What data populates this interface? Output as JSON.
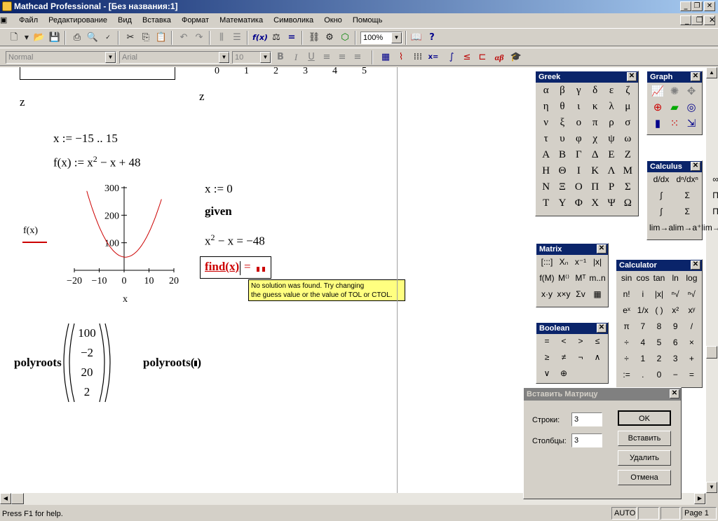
{
  "window": {
    "title": "Mathcad Professional - [Без названия:1]"
  },
  "menu": [
    "Файл",
    "Редактирование",
    "Вид",
    "Вставка",
    "Формат",
    "Математика",
    "Символика",
    "Окно",
    "Помощь"
  ],
  "toolbar": {
    "zoom": "100%"
  },
  "format": {
    "style": "Normal",
    "font": "Arial",
    "size": "10",
    "bold": "B",
    "italic": "I",
    "underline": "U"
  },
  "math_toolbar": {
    "eval": "x=",
    "greek": "αβ"
  },
  "worksheet": {
    "top_ticks": [
      "0",
      "1",
      "2",
      "3",
      "4",
      "5"
    ],
    "z_left": "z",
    "z_right": "z",
    "range_def": "x := −15 .. 15",
    "func_def_prefix": "f(x) := x",
    "func_def_exp": "2",
    "func_def_suffix": " − x + 48",
    "x_init": "x := 0",
    "given": "given",
    "eq_prefix": "x",
    "eq_exp": "2",
    "eq_suffix": " − x = −48",
    "find_expr": "find(x)",
    "find_eq": "=",
    "tooltip_line1": "No solution was found. Try changing",
    "tooltip_line2": "the guess value or the value of TOL or CTOL.",
    "polyroots": "polyroots",
    "vector": [
      "100",
      "−2",
      "20",
      "2"
    ],
    "polyroots2": "polyroots",
    "plot": {
      "ylabel": "f(x)",
      "xlabel": "x",
      "yticks": [
        "300",
        "200",
        "100"
      ],
      "xticks": [
        "−20",
        "−10",
        "0",
        "10",
        "20"
      ]
    }
  },
  "chart_data": {
    "type": "line",
    "xlabel": "x",
    "ylabel": "f(x)",
    "xlim": [
      -20,
      20
    ],
    "ylim": [
      0,
      300
    ],
    "series": [
      {
        "x": [
          -15,
          -12,
          -9,
          -6,
          -3,
          0,
          3,
          6,
          9,
          12,
          15
        ],
        "y": [
          288,
          204,
          138,
          90,
          60,
          48,
          54,
          78,
          120,
          180,
          258
        ]
      }
    ]
  },
  "greek": {
    "title": "Greek",
    "letters": [
      "α",
      "β",
      "γ",
      "δ",
      "ε",
      "ζ",
      "η",
      "θ",
      "ι",
      "κ",
      "λ",
      "μ",
      "ν",
      "ξ",
      "ο",
      "π",
      "ρ",
      "σ",
      "τ",
      "υ",
      "φ",
      "χ",
      "ψ",
      "ω",
      "Α",
      "Β",
      "Γ",
      "Δ",
      "Ε",
      "Ζ",
      "Η",
      "Θ",
      "Ι",
      "Κ",
      "Λ",
      "Μ",
      "Ν",
      "Ξ",
      "Ο",
      "Π",
      "Ρ",
      "Σ",
      "Τ",
      "Υ",
      "Φ",
      "Χ",
      "Ψ",
      "Ω"
    ]
  },
  "graph_palette": {
    "title": "Graph"
  },
  "calculus": {
    "title": "Calculus",
    "items": [
      "d/dx",
      "dⁿ/dxⁿ",
      "∞",
      "∫",
      "Σ",
      "Π",
      "∫",
      "Σ",
      "Π",
      "lim→a",
      "lim→a⁺",
      "lim→a⁻"
    ]
  },
  "matrix": {
    "title": "Matrix",
    "items": [
      "[:::]",
      "Xₙ",
      "x⁻¹",
      "|x|",
      "f(M)",
      "M⁽⁾",
      "Mᵀ",
      "m..n",
      "x·y",
      "x×y",
      "Σv",
      "▦"
    ]
  },
  "calculator": {
    "title": "Calculator",
    "items": [
      "sin",
      "cos",
      "tan",
      "ln",
      "log",
      "n!",
      "i",
      "|x|",
      "ⁿ√",
      "ⁿ√",
      "eˣ",
      "1/x",
      "( )",
      "x²",
      "xʸ",
      "π",
      "7",
      "8",
      "9",
      "/",
      "÷",
      "4",
      "5",
      "6",
      "×",
      "÷",
      "1",
      "2",
      "3",
      "+",
      ":=",
      ".",
      "0",
      "−",
      "="
    ]
  },
  "boolean": {
    "title": "Boolean",
    "items": [
      "=",
      "<",
      ">",
      "≤",
      "≥",
      "≠",
      "¬",
      "∧",
      "∨",
      "⊕"
    ]
  },
  "dialog": {
    "title": "Вставить Матрицу",
    "rows_label": "Строки:",
    "rows_value": "3",
    "cols_label": "Столбцы:",
    "cols_value": "3",
    "ok": "OK",
    "insert": "Вставить",
    "delete": "Удалить",
    "cancel": "Отмена"
  },
  "status": {
    "help": "Press F1 for help.",
    "mode": "AUTO",
    "page": "Page 1"
  }
}
